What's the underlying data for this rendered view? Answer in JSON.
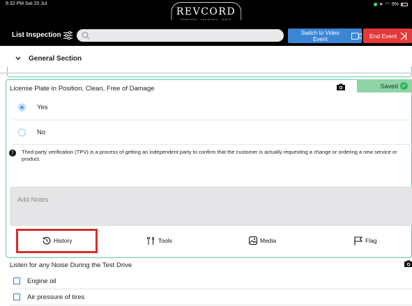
{
  "status": {
    "time": "8:32 PM  Sat 20 Jul",
    "battery": "9%"
  },
  "brand": {
    "name": "REVCORD",
    "tagline": "inspection · operations · report"
  },
  "toolbar": {
    "title": "List Inspection",
    "search_placeholder": "",
    "video_label": "Switch to Video Event",
    "end_label": "End Event"
  },
  "section": {
    "title": "General Section"
  },
  "question1": {
    "title": "License Plate in Position, Clean, Free of Damage",
    "saved": "Saved",
    "options": [
      {
        "label": "Yes",
        "selected": true
      },
      {
        "label": "No",
        "selected": false
      }
    ],
    "info": "Third-party verification (TPV) is a process of getting an independent party to confirm that the customer is actually requesting a change or ordering a new service or product.",
    "notes_placeholder": "Add Notes",
    "tools": {
      "history": "History",
      "tools": "Tools",
      "media": "Media",
      "flag": "Flag"
    }
  },
  "question2": {
    "title": "Listen for any Noise During the Test Drive",
    "items": [
      "Engine oil",
      "Air pressure of tires"
    ]
  },
  "colors": {
    "teal_border": "#5fcaa4",
    "saved_bg": "#8fd4a6",
    "video_btn": "#3a86d4",
    "end_btn": "#e53a3a",
    "highlight": "#d62c2c"
  }
}
